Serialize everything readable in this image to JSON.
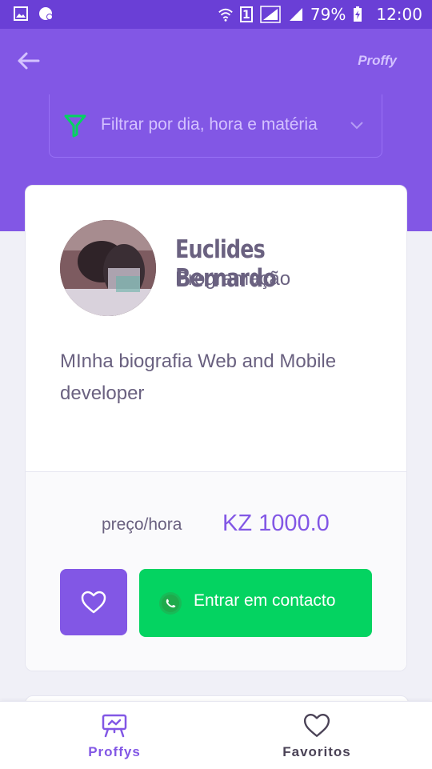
{
  "status_bar": {
    "battery": "79%",
    "time": "12:00",
    "sim": "1"
  },
  "header": {
    "back_icon": "arrow-left-icon",
    "brand": "Proffy"
  },
  "filter": {
    "icon": "filter-icon",
    "label": "Filtrar por dia, hora e matéria",
    "chevron": "chevron-down-icon"
  },
  "teacher": {
    "name": "Euclides Bernardo",
    "subject": "Programação",
    "bio": "MInha biografia Web and Mobile developer",
    "price_label": "preço/hora",
    "price_value": "KZ 1000.0",
    "favorite_icon": "heart-icon",
    "contact_label": "Entrar em contacto",
    "contact_icon": "whatsapp-icon"
  },
  "tabs": [
    {
      "label": "Proffys",
      "icon": "easel-icon",
      "active": true
    },
    {
      "label": "Favoritos",
      "icon": "heart-icon",
      "active": false
    }
  ],
  "colors": {
    "primary": "#8257e5",
    "primary_dark": "#6a3fd6",
    "success": "#04d361",
    "text": "#6a6180"
  }
}
